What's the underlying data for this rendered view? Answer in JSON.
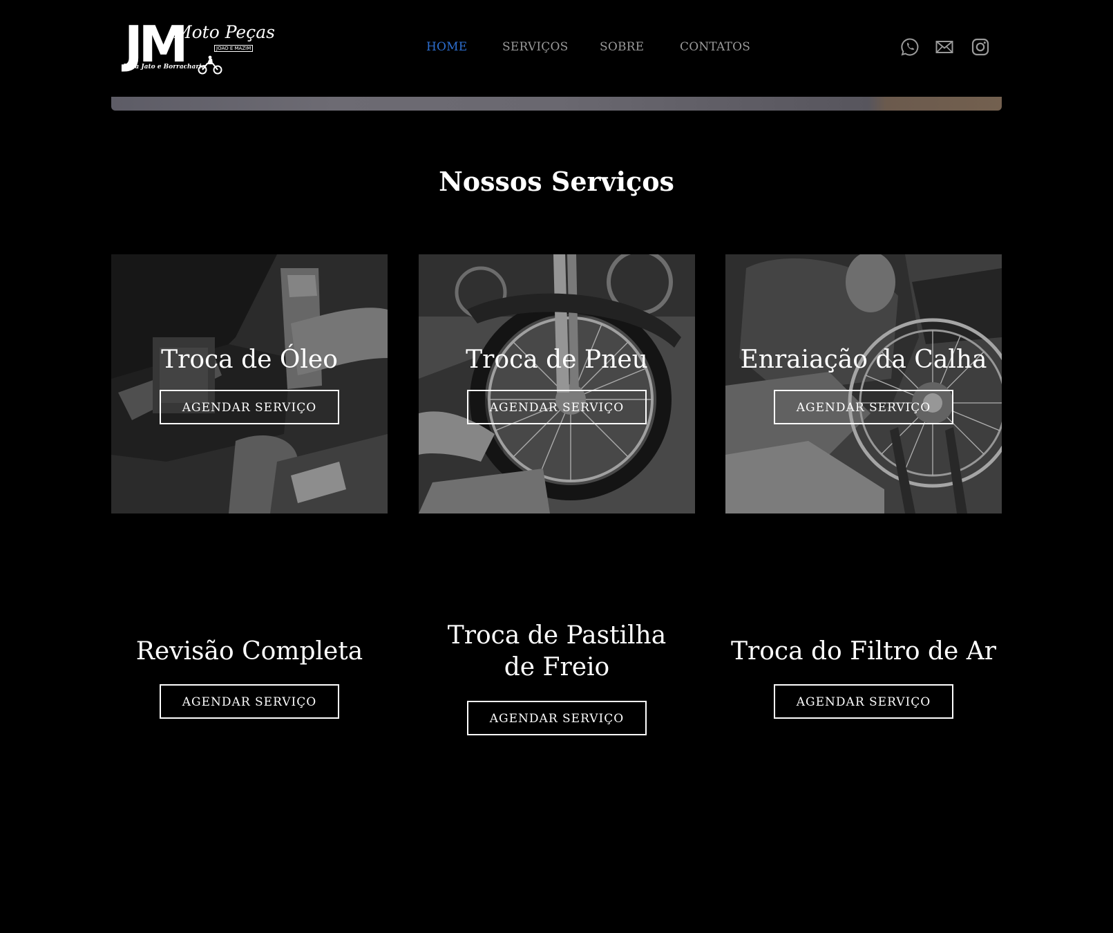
{
  "brand": {
    "logo_main": "JM",
    "logo_script": "Moto Peças",
    "logo_tag": "JOÃO E MAZIM",
    "logo_sub": "Lava Jato e Borracharia"
  },
  "nav": {
    "items": [
      {
        "label": "HOME",
        "active": true
      },
      {
        "label": "SERVIÇOS",
        "active": false
      },
      {
        "label": "SOBRE",
        "active": false
      },
      {
        "label": "CONTATOS",
        "active": false
      }
    ],
    "active_color": "#2d6ecf",
    "inactive_color": "#9a9a9a"
  },
  "social": {
    "icons": [
      "whatsapp-icon",
      "mail-icon",
      "instagram-icon"
    ]
  },
  "services": {
    "title": "Nossos Serviços",
    "items": [
      {
        "title": "Troca de Óleo",
        "button": "AGENDAR SERVIÇO",
        "image": "grayscale photo: pouring oil into motorcycle engine"
      },
      {
        "title": "Troca de Pneu",
        "button": "AGENDAR SERVIÇO",
        "image": "grayscale photo: motorcycle front wheel"
      },
      {
        "title": "Enraiação da Calha",
        "button": "AGENDAR SERVIÇO",
        "image": "grayscale photo: mechanic truing a spoked wheel"
      },
      {
        "title": "Revisão Completa",
        "button": "AGENDAR SERVIÇO"
      },
      {
        "title": "Troca de Pastilha de Freio",
        "button": "AGENDAR SERVIÇO"
      },
      {
        "title": "Troca do Filtro de Ar",
        "button": "AGENDAR SERVIÇO"
      }
    ]
  }
}
